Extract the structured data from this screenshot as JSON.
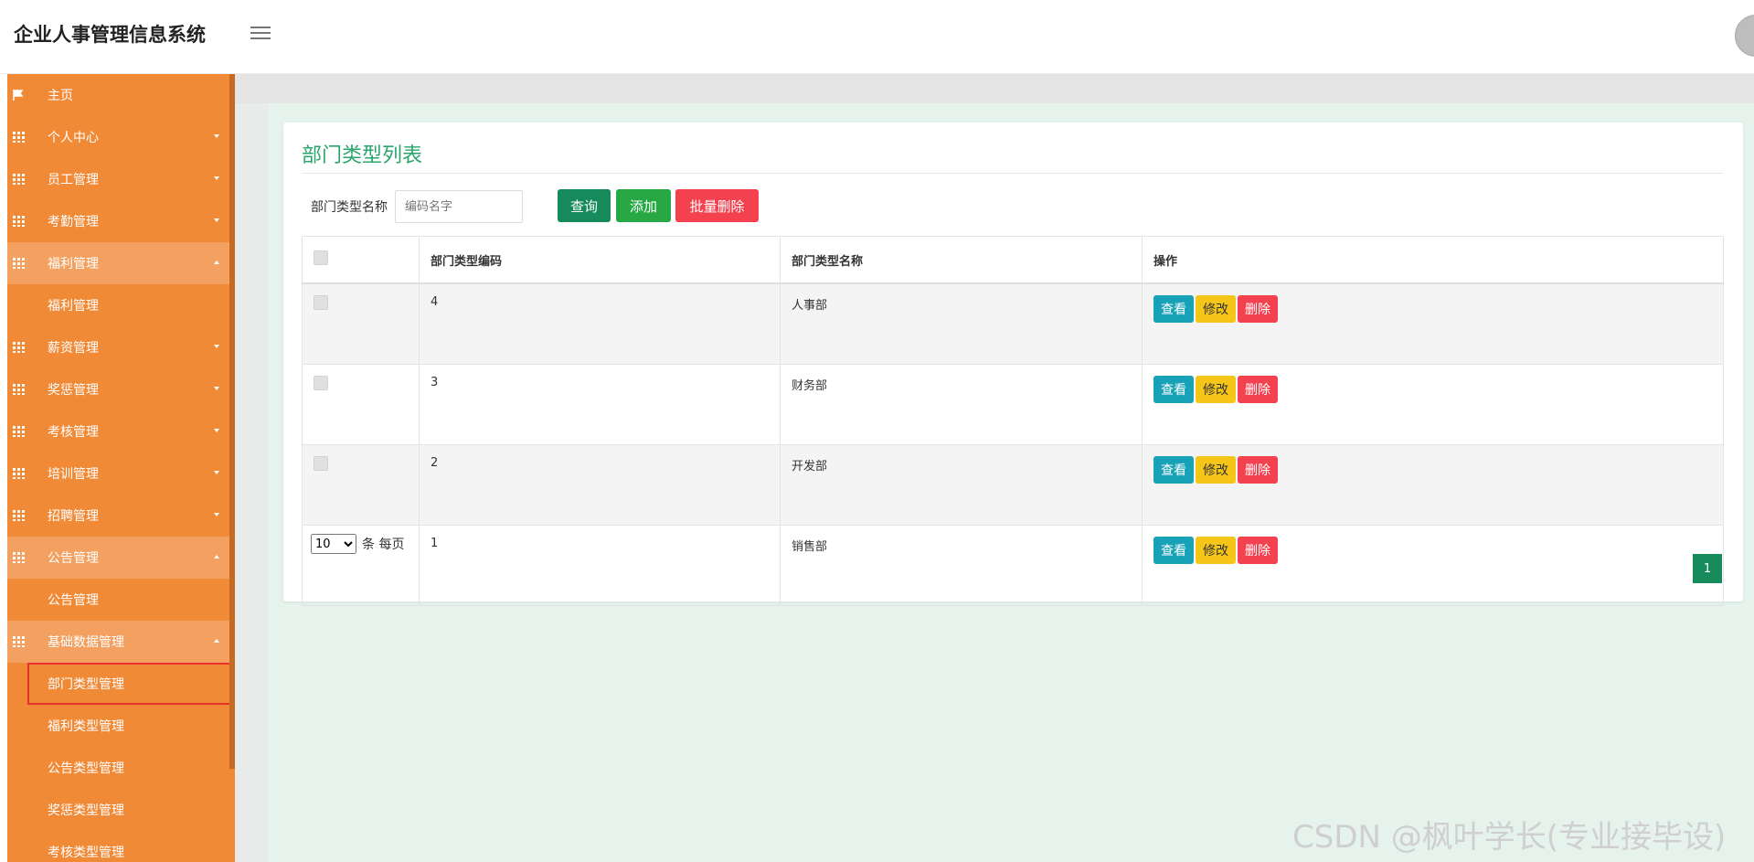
{
  "app": {
    "title": "企业人事管理信息系统"
  },
  "sidebar": {
    "items": [
      {
        "label": "主页",
        "icon": "flag-icon",
        "expanded": false
      },
      {
        "label": "个人中心",
        "icon": "grid-icon",
        "expanded": false
      },
      {
        "label": "员工管理",
        "icon": "grid-icon",
        "expanded": false
      },
      {
        "label": "考勤管理",
        "icon": "grid-icon",
        "expanded": false
      },
      {
        "label": "福利管理",
        "icon": "grid-icon",
        "expanded": true,
        "children": [
          "福利管理"
        ]
      },
      {
        "label": "薪资管理",
        "icon": "grid-icon",
        "expanded": false
      },
      {
        "label": "奖惩管理",
        "icon": "grid-icon",
        "expanded": false
      },
      {
        "label": "考核管理",
        "icon": "grid-icon",
        "expanded": false
      },
      {
        "label": "培训管理",
        "icon": "grid-icon",
        "expanded": false
      },
      {
        "label": "招聘管理",
        "icon": "grid-icon",
        "expanded": false
      },
      {
        "label": "公告管理",
        "icon": "grid-icon",
        "expanded": true,
        "children": [
          "公告管理"
        ]
      },
      {
        "label": "基础数据管理",
        "icon": "grid-icon",
        "expanded": true,
        "children": [
          "部门类型管理",
          "福利类型管理",
          "公告类型管理",
          "奖惩类型管理",
          "考核类型管理"
        ]
      }
    ]
  },
  "page": {
    "title": "部门类型列表",
    "search": {
      "label": "部门类型名称",
      "placeholder": "编码名字",
      "value": ""
    },
    "buttons": {
      "query": "查询",
      "add": "添加",
      "batch_delete": "批量删除"
    },
    "table": {
      "headers": [
        "",
        "部门类型编码",
        "部门类型名称",
        "操作"
      ],
      "rows": [
        {
          "code": "4",
          "name": "人事部"
        },
        {
          "code": "3",
          "name": "财务部"
        },
        {
          "code": "2",
          "name": "开发部"
        },
        {
          "code": "1",
          "name": "销售部"
        }
      ],
      "actions": {
        "view": "查看",
        "edit": "修改",
        "delete": "删除"
      }
    },
    "pager": {
      "page_size": "10",
      "per_page_label": "条 每页",
      "current_page": "1"
    }
  },
  "watermark": "CSDN @枫叶学长(专业接毕设)",
  "colors": {
    "sidebar": "#f08a37",
    "accent_green": "#168a5a",
    "title_green": "#2aa66b",
    "danger": "#f3414f",
    "info": "#17a2b8",
    "warning": "#f5c518"
  }
}
